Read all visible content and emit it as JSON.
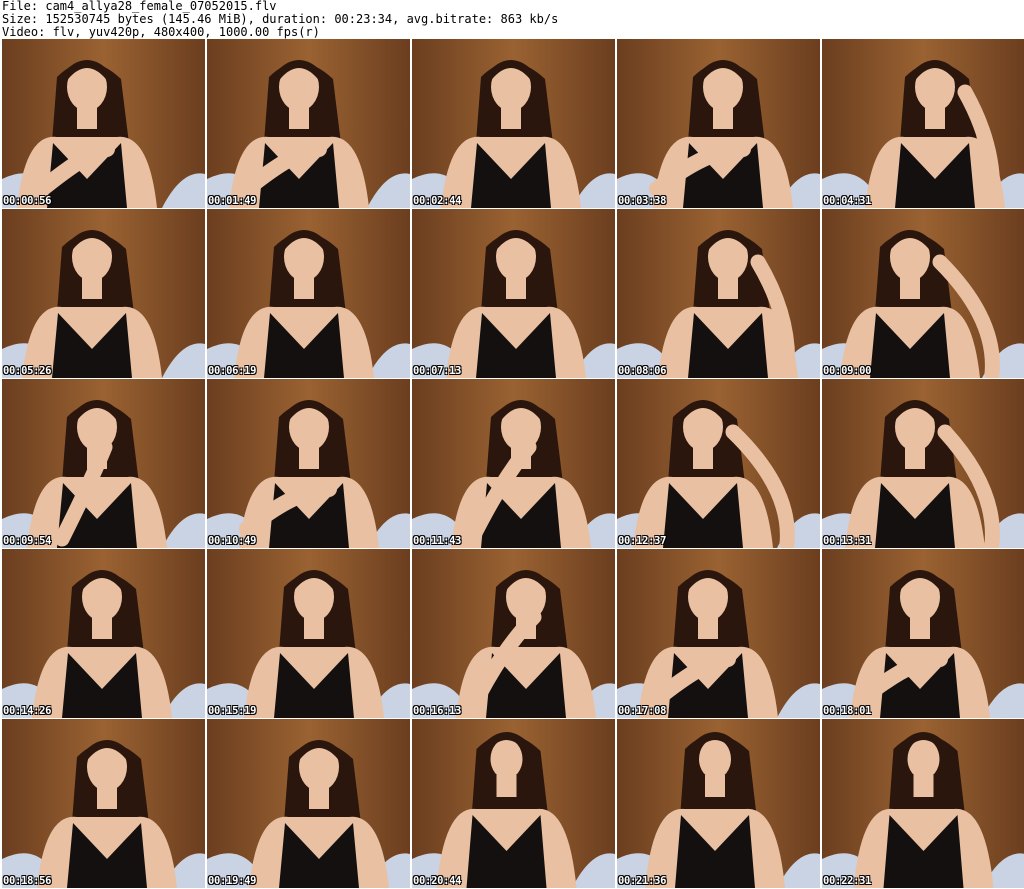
{
  "header": {
    "file_line": "File: cam4_allya28_female_07052015.flv",
    "size_line": "Size: 152530745 bytes (145.46 MiB), duration: 00:23:34, avg.bitrate: 863 kb/s",
    "video_line": "Video: flv, yuv420p, 480x400, 1000.00 fps(r)"
  },
  "colors": {
    "curtain": "#6b3e1f",
    "curtain_light": "#9a6232",
    "skin": "#e9c0a2",
    "hair": "#2a160c",
    "top": "#141010",
    "pillow": "#c9d3e4"
  },
  "thumbnails": [
    {
      "time": "00:00:56",
      "icon": "webcam-frame",
      "pose": "hand-on-chest"
    },
    {
      "time": "00:01:49",
      "icon": "webcam-frame",
      "pose": "arms-crossed"
    },
    {
      "time": "00:02:44",
      "icon": "webcam-frame",
      "pose": "neutral"
    },
    {
      "time": "00:03:38",
      "icon": "webcam-frame",
      "pose": "hand-on-shoulder"
    },
    {
      "time": "00:04:31",
      "icon": "webcam-frame",
      "pose": "hand-in-hair"
    },
    {
      "time": "00:05:26",
      "icon": "webcam-frame",
      "pose": "neutral"
    },
    {
      "time": "00:06:19",
      "icon": "webcam-frame",
      "pose": "neutral"
    },
    {
      "time": "00:07:13",
      "icon": "webcam-frame",
      "pose": "neutral"
    },
    {
      "time": "00:08:06",
      "icon": "webcam-frame",
      "pose": "hand-in-hair"
    },
    {
      "time": "00:09:00",
      "icon": "webcam-frame",
      "pose": "hands-on-hair"
    },
    {
      "time": "00:09:54",
      "icon": "webcam-frame",
      "pose": "hand-on-face"
    },
    {
      "time": "00:10:49",
      "icon": "webcam-frame",
      "pose": "arms-crossed"
    },
    {
      "time": "00:11:43",
      "icon": "webcam-frame",
      "pose": "hand-on-face"
    },
    {
      "time": "00:12:37",
      "icon": "webcam-frame",
      "pose": "arm-raised"
    },
    {
      "time": "00:13:31",
      "icon": "webcam-frame",
      "pose": "hands-on-hair"
    },
    {
      "time": "00:14:26",
      "icon": "webcam-frame",
      "pose": "neutral"
    },
    {
      "time": "00:15:19",
      "icon": "webcam-frame",
      "pose": "neutral"
    },
    {
      "time": "00:16:13",
      "icon": "webcam-frame",
      "pose": "hand-on-face"
    },
    {
      "time": "00:17:08",
      "icon": "webcam-frame",
      "pose": "hand-on-shoulder"
    },
    {
      "time": "00:18:01",
      "icon": "webcam-frame",
      "pose": "arms-crossed"
    },
    {
      "time": "00:18:56",
      "icon": "webcam-frame",
      "pose": "neutral"
    },
    {
      "time": "00:19:49",
      "icon": "webcam-frame",
      "pose": "neutral"
    },
    {
      "time": "00:20:44",
      "icon": "webcam-frame",
      "pose": "neutral-far"
    },
    {
      "time": "00:21:36",
      "icon": "webcam-frame",
      "pose": "neutral-far"
    },
    {
      "time": "00:22:31",
      "icon": "webcam-frame",
      "pose": "neutral-far"
    }
  ]
}
